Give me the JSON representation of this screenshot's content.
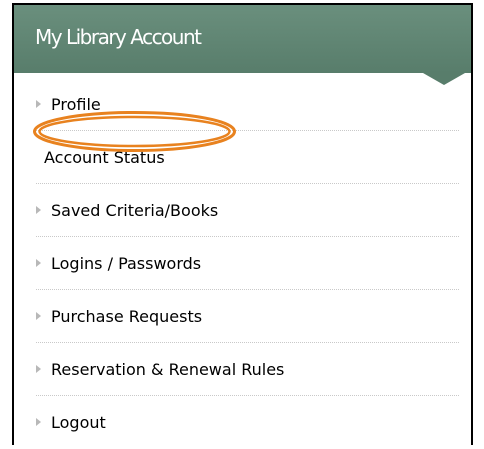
{
  "header": {
    "title": "My Library Account"
  },
  "menu": {
    "items": [
      {
        "label": "Profile",
        "icon": "triangle-bullet-icon"
      },
      {
        "label": "Account Status",
        "icon": null,
        "highlighted": true
      },
      {
        "label": "Saved Criteria/Books",
        "icon": "triangle-bullet-icon"
      },
      {
        "label": "Logins / Passwords",
        "icon": "triangle-bullet-icon"
      },
      {
        "label": "Purchase Requests",
        "icon": "triangle-bullet-icon"
      },
      {
        "label": "Reservation & Renewal Rules",
        "icon": "triangle-bullet-icon"
      },
      {
        "label": "Logout",
        "icon": "triangle-bullet-icon"
      }
    ]
  },
  "colors": {
    "header_bg": "#587d6b",
    "highlight_ring": "#e8821f",
    "bullet": "#b8b8b8",
    "divider": "#c9c9c9"
  }
}
